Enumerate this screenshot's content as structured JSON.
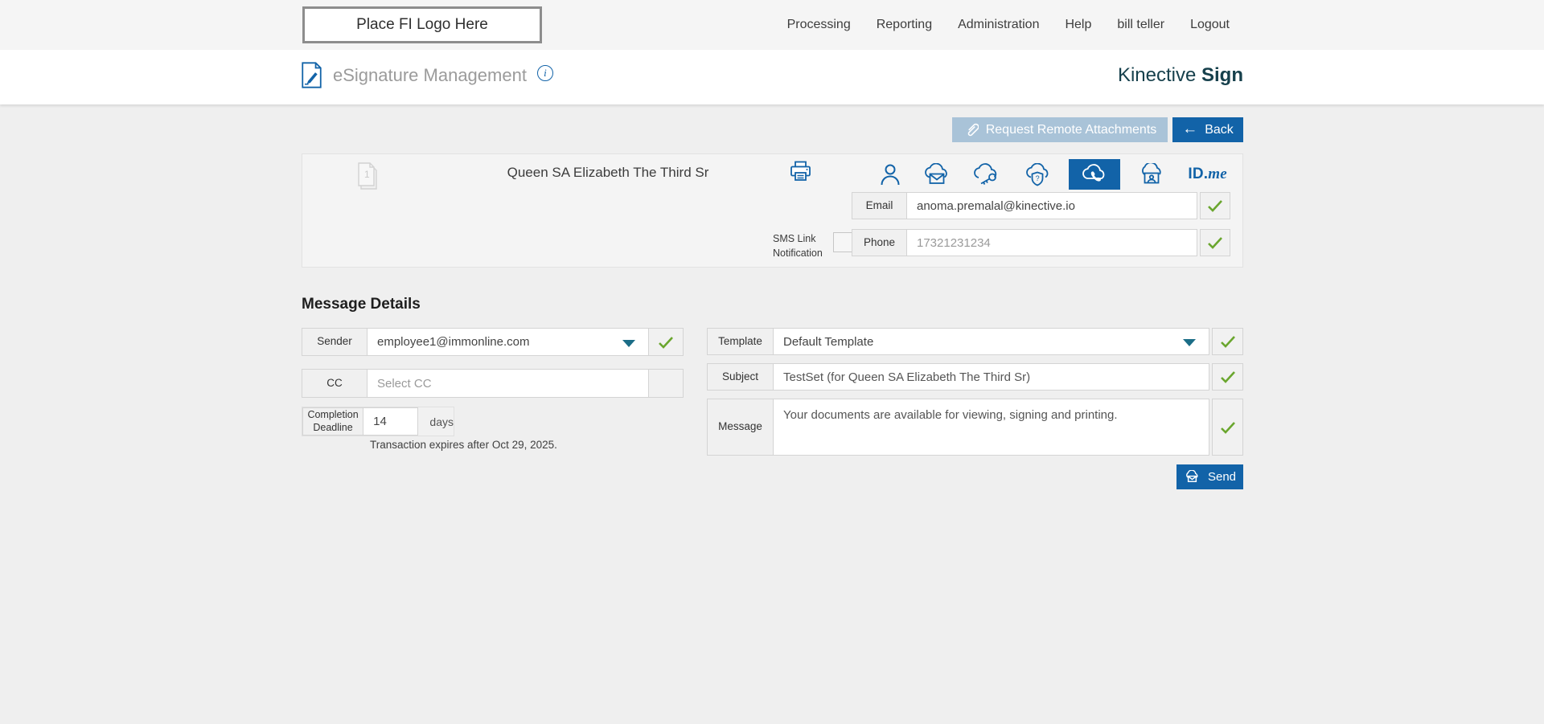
{
  "topbar": {
    "logo_text": "Place FI Logo Here",
    "nav": [
      {
        "label": "Processing"
      },
      {
        "label": "Reporting"
      },
      {
        "label": "Administration"
      },
      {
        "label": "Help"
      },
      {
        "label": "bill teller"
      },
      {
        "label": "Logout"
      }
    ]
  },
  "header": {
    "title": "eSignature Management",
    "info_glyph": "i",
    "brand_name": "Kinective",
    "brand_product": "Sign"
  },
  "actions": {
    "request_remote_attachments": "Request Remote Attachments",
    "back": "Back"
  },
  "recipient": {
    "document_count": "1",
    "name": "Queen SA Elizabeth The Third Sr",
    "auth_icons": [
      "in-person-signer",
      "cloud-email",
      "cloud-key",
      "cloud-security-question",
      "cloud-phone-selected",
      "cloud-kiosk",
      "idme"
    ],
    "selected_auth": "cloud-phone",
    "idme": {
      "id": "ID.",
      "me": "me"
    },
    "email": {
      "label": "Email",
      "value": "anoma.premalal@kinective.io",
      "valid": true
    },
    "sms": {
      "label_line1": "SMS Link",
      "label_line2": "Notification",
      "checked": false
    },
    "phone": {
      "label": "Phone",
      "value": "17321231234",
      "valid": true
    }
  },
  "message_details": {
    "heading": "Message Details",
    "sender": {
      "label": "Sender",
      "value": "employee1@immonline.com",
      "valid": true
    },
    "cc": {
      "label": "CC",
      "placeholder": "Select CC"
    },
    "completion_deadline": {
      "label_line1": "Completion",
      "label_line2": "Deadline",
      "value": "14",
      "unit": "days"
    },
    "expiry_note": "Transaction expires after Oct 29, 2025.",
    "template": {
      "label": "Template",
      "value": "Default Template",
      "valid": true
    },
    "subject": {
      "label": "Subject",
      "value": "TestSet (for Queen SA Elizabeth The Third Sr)",
      "valid": true
    },
    "message": {
      "label": "Message",
      "value": "Your documents are available for viewing, signing and printing.",
      "valid": true
    },
    "send_label": "Send"
  },
  "colors": {
    "accent_blue": "#1263a8",
    "muted_blue": "#a9c3d8",
    "teal_caret": "#1b6d87",
    "valid_green": "#6aa62e",
    "brand_teal": "#16404c",
    "topbar_bg": "#f5f5f5",
    "page_bg": "#efefef",
    "card_bg": "#f4f4f4"
  }
}
